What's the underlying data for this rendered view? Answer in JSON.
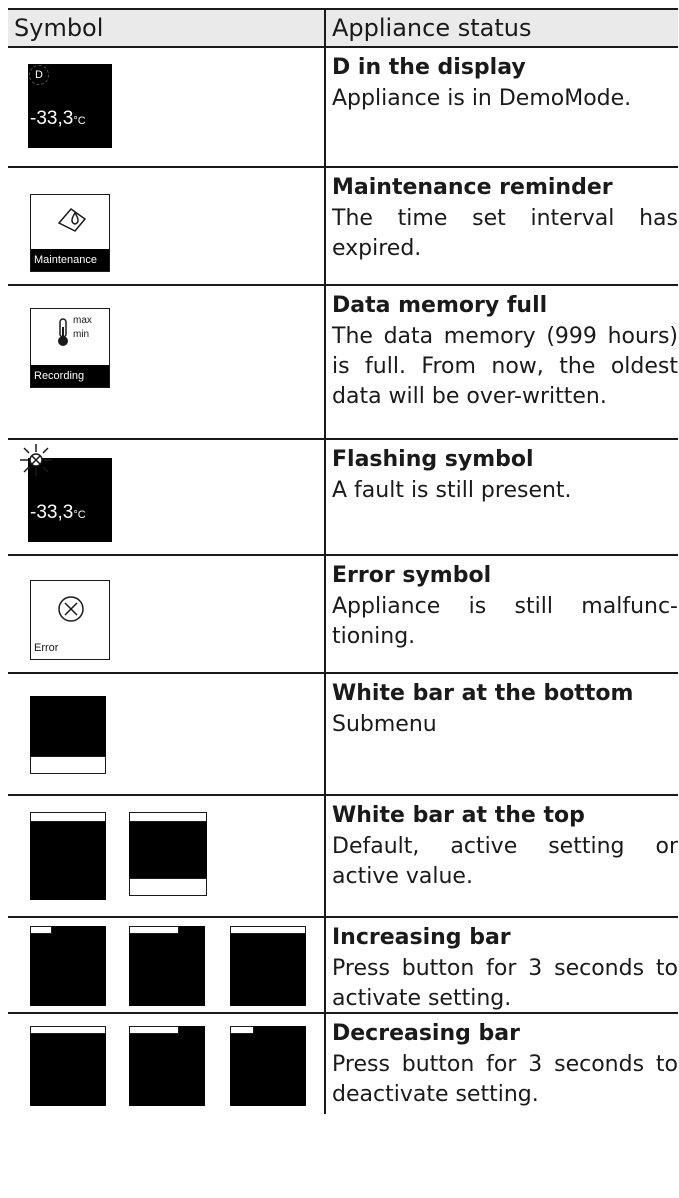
{
  "header": {
    "col_symbol": "Symbol",
    "col_status": "Appliance status"
  },
  "rows": [
    {
      "title": "D in the display",
      "desc": "Appliance is in DemoMode.",
      "icon_temp": "-33,3",
      "icon_unit": "°C",
      "icon_letter": "D"
    },
    {
      "title": "Maintenance reminder",
      "desc": "The time set interval has expired.",
      "icon_label": "Maintenance"
    },
    {
      "title": "Data memory full",
      "desc": "The data memory (999 hours) is full. From now, the oldest data will be over-written.",
      "icon_label": "Recording",
      "icon_max": "max",
      "icon_min": "min"
    },
    {
      "title": "Flashing symbol",
      "desc": "A fault is still present.",
      "icon_temp": "-33,3",
      "icon_unit": "°C"
    },
    {
      "title": "Error symbol",
      "desc": "Appliance is still malfunc-tioning.",
      "icon_label": "Error"
    },
    {
      "title": "White bar at the bottom",
      "desc": "Submenu"
    },
    {
      "title": "White bar at the top",
      "desc": "Default, active setting or active value."
    },
    {
      "title": "Increasing bar",
      "desc": "Press button for 3 seconds to activate setting."
    },
    {
      "title": "Decreasing bar",
      "desc": "Press button for 3 seconds to deactivate setting."
    }
  ]
}
